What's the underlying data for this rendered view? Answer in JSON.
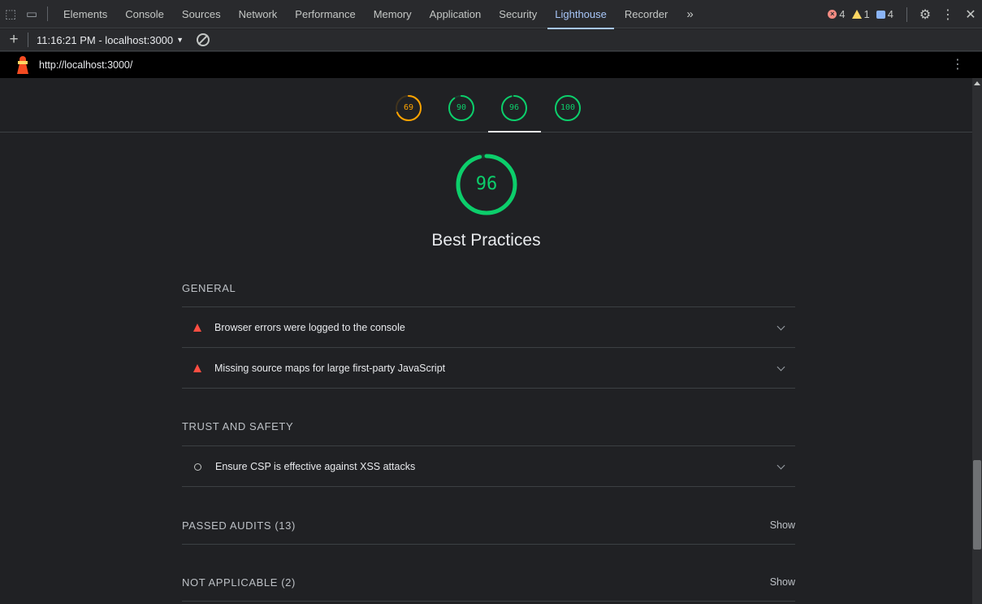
{
  "devtools": {
    "tabs": [
      {
        "label": "Elements"
      },
      {
        "label": "Console"
      },
      {
        "label": "Sources"
      },
      {
        "label": "Network"
      },
      {
        "label": "Performance"
      },
      {
        "label": "Memory"
      },
      {
        "label": "Application"
      },
      {
        "label": "Security"
      },
      {
        "label": "Lighthouse",
        "active": true
      },
      {
        "label": "Recorder"
      }
    ],
    "more_tabs": "»",
    "counts": {
      "errors": "4",
      "warnings": "1",
      "messages": "4"
    }
  },
  "report_bar": {
    "plus": "+",
    "report_select": "11:16:21 PM - localhost:3000",
    "caret": "▼"
  },
  "url_bar": {
    "url": "http://localhost:3000/",
    "menu": "⋮"
  },
  "gauges": [
    {
      "score": "69",
      "color": "#ffa400",
      "fraction": 0.69
    },
    {
      "score": "90",
      "color": "#0cce6b",
      "fraction": 0.9
    },
    {
      "score": "96",
      "color": "#0cce6b",
      "fraction": 0.96,
      "active": true
    },
    {
      "score": "100",
      "color": "#0cce6b",
      "fraction": 1.0
    }
  ],
  "category": {
    "score": "96",
    "color": "#0cce6b",
    "fraction": 0.96,
    "title": "Best Practices"
  },
  "groups": {
    "general": {
      "title": "GENERAL",
      "audits": [
        {
          "text": "Browser errors were logged to the console"
        },
        {
          "text": "Missing source maps for large first-party JavaScript"
        }
      ]
    },
    "trust": {
      "title": "TRUST AND SAFETY",
      "audits": [
        {
          "text": "Ensure CSP is effective against XSS attacks"
        }
      ]
    },
    "passed": {
      "title": "PASSED AUDITS (13)",
      "show": "Show"
    },
    "not_applicable": {
      "title": "NOT APPLICABLE (2)",
      "show": "Show"
    }
  }
}
